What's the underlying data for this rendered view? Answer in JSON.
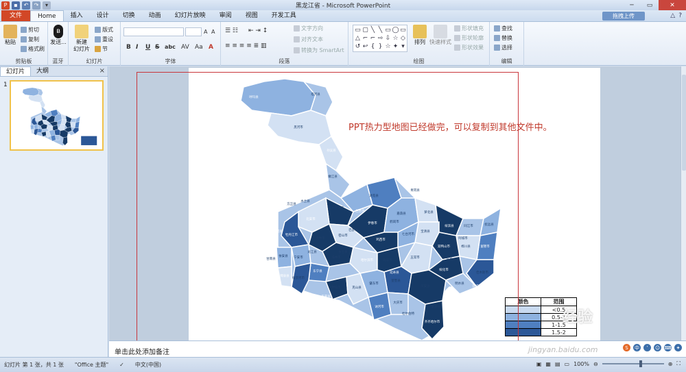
{
  "app": {
    "window_title": "黑龙江省 - Microsoft PowerPoint",
    "upload_button": "拖拽上传"
  },
  "tabs": [
    "文件",
    "Home",
    "插入",
    "设计",
    "切换",
    "动画",
    "幻灯片放映",
    "审阅",
    "视图",
    "开发工具"
  ],
  "ribbon": {
    "clipboard": {
      "paste": "粘贴",
      "cut": "剪切",
      "copy": "复制",
      "format_painter": "格式刷",
      "label": "剪贴板"
    },
    "bluetooth": {
      "send": "发送...",
      "label": "蓝牙"
    },
    "slides": {
      "new_slide": "新建\n幻灯片",
      "layout": "版式",
      "reset": "重设",
      "section": "节",
      "label": "幻灯片"
    },
    "font": {
      "label": "字体",
      "bold": "B",
      "italic": "I",
      "underline": "U",
      "strike": "S",
      "shadow": "abc"
    },
    "paragraph": {
      "text_direction": "文字方向",
      "align_text": "对齐文本",
      "smartart": "转换为 SmartArt",
      "label": "段落"
    },
    "drawing": {
      "arrange": "排列",
      "quick_styles": "快速样式",
      "shape_fill": "形状填充",
      "shape_outline": "形状轮廓",
      "shape_effects": "形状效果",
      "label": "绘图"
    },
    "editing": {
      "find": "查找",
      "replace": "替换",
      "select": "选择",
      "label": "编辑"
    }
  },
  "panel": {
    "tab_slides": "幻灯片",
    "tab_outline": "大纲",
    "close": "×",
    "slide_number": "1"
  },
  "slide": {
    "caption": "PPT热力型地图已经做完，可以复制到其他文件中。",
    "legend": {
      "headers": [
        "颜色",
        "范围"
      ],
      "rows": [
        {
          "color": "#c8d9ef",
          "range": "<0.5"
        },
        {
          "color": "#8eb2e0",
          "range": "0.5-1"
        },
        {
          "color": "#4f7fc0",
          "range": "1-1.5"
        },
        {
          "color": "#2b5797",
          "range": "1.5-2"
        }
      ]
    },
    "map_labels": [
      "呼玛县",
      "塔河县",
      "黑河市",
      "孙吴县",
      "嫩江县",
      "五大连池市",
      "北安市",
      "逊克县",
      "嘉荫县",
      "伊春市",
      "鹤岗市",
      "萝北县",
      "绥滨县",
      "同江市",
      "抚远县",
      "富锦市",
      "佳木斯市",
      "桦川县",
      "双鸭山市",
      "宝清县",
      "七台河市",
      "鸡西市",
      "密山市",
      "虎林市",
      "牡丹江市",
      "宁安市",
      "海林市",
      "东宁县",
      "绥芬河市",
      "穆棱市",
      "哈尔滨市",
      "尚志市",
      "五常市",
      "绥化市",
      "望奎县",
      "庆安县",
      "齐齐哈尔市",
      "大庆市",
      "肇东市",
      "讷河市",
      "克山县",
      "依安县",
      "拜泉县",
      "明水县",
      "青冈县",
      "兰西县",
      "巴彦县",
      "木兰县",
      "通河县",
      "方正县",
      "依兰县",
      "延寿县",
      "宾县",
      "阿城市",
      "双城市",
      "肇源县",
      "杜尔伯特",
      "泰来县",
      "龙江县",
      "甘南县",
      "富裕县"
    ]
  },
  "notes": {
    "placeholder": "单击此处添加备注"
  },
  "status": {
    "slide_info": "幻灯片 第 1 张，共 1 张",
    "theme": "\"Office 主题\"",
    "language": "中文(中国)",
    "zoom": "100%"
  },
  "watermark": {
    "text": "经验",
    "url": "jingyan.baidu.com"
  },
  "colors": {
    "dark": "#163a66",
    "mid": "#4f7fc0",
    "light": "#a9c4e7",
    "pale": "#d3e1f3",
    "accent": "#c0392b"
  }
}
